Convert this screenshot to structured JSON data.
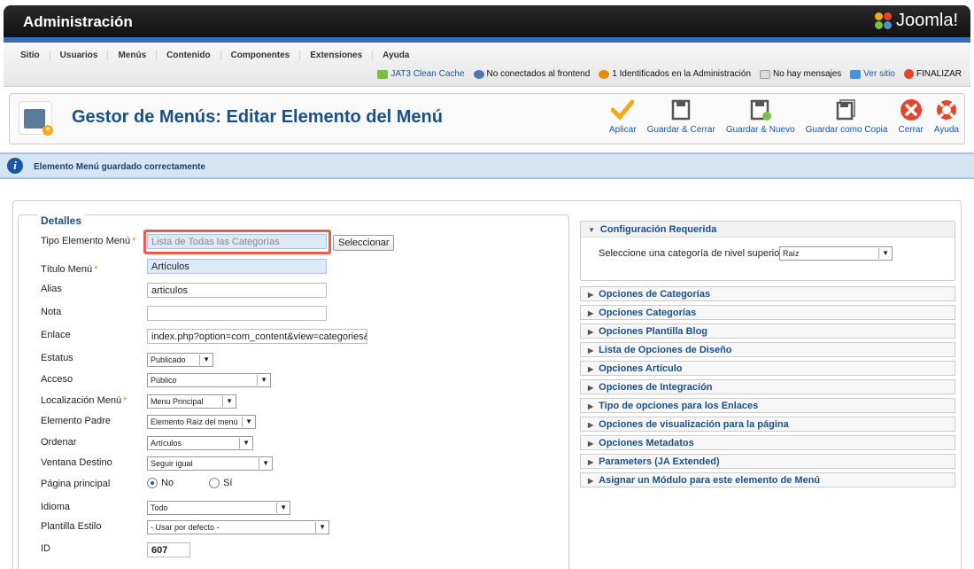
{
  "header": {
    "title": "Administración",
    "logo_text": "Joomla!"
  },
  "menu": [
    "Sitio",
    "Usuarios",
    "Menús",
    "Contenido",
    "Componentes",
    "Extensiones",
    "Ayuda"
  ],
  "status": {
    "cache": "JAT3 Clean Cache",
    "frontend": "No conectados al frontend",
    "admin": "1 Identificados en la Administración",
    "messages": "No hay mensajes",
    "view_site": "Ver sitio",
    "logout": "FINALIZAR"
  },
  "page": {
    "title": "Gestor de Menús: Editar Elemento del Menú"
  },
  "toolbar": {
    "apply": "Aplicar",
    "save_close": "Guardar & Cerrar",
    "save_new": "Guardar & Nuevo",
    "save_copy": "Guardar como Copia",
    "close": "Cerrar",
    "help": "Ayuda"
  },
  "message": "Elemento Menú guardado correctamente",
  "details": {
    "legend": "Detalles",
    "tipo_label": "Tipo Elemento Menú",
    "tipo_value": "Lista de Todas las Categorías",
    "select_btn": "Seleccionar",
    "titulo_label": "Título Menú",
    "titulo_value": "Artículos",
    "alias_label": "Alias",
    "alias_value": "articulos",
    "nota_label": "Nota",
    "nota_value": "",
    "enlace_label": "Enlace",
    "enlace_value": "index.php?option=com_content&view=categories&id=",
    "estatus_label": "Estatus",
    "estatus_value": "Publicado",
    "acceso_label": "Acceso",
    "acceso_value": "Público",
    "localizacion_label": "Localización Menú",
    "localizacion_value": "Menu Principal",
    "padre_label": "Elemento Padre",
    "padre_value": "Elemento Raíz del menú",
    "ordenar_label": "Ordenar",
    "ordenar_value": "Artículos",
    "ventana_label": "Ventana Destino",
    "ventana_value": "Seguir igual",
    "principal_label": "Página principal",
    "radio_no": "No",
    "radio_si": "Sí",
    "idioma_label": "Idioma",
    "idioma_value": "Todo",
    "plantilla_label": "Plantilla Estilo",
    "plantilla_value": "- Usar por defecto -",
    "id_label": "ID",
    "id_value": "607"
  },
  "right": {
    "req_title": "Configuración Requerida",
    "req_label": "Seleccione una categoría de nivel superior",
    "req_value": "Raíz",
    "accordions": [
      "Opciones de Categorías",
      "Opciones Categorías",
      "Opciones Plantilla Blog",
      "Lista de Opciones de Diseño",
      "Opciones Artículo",
      "Opciones de Integración",
      "Tipo de opciones para los Enlaces",
      "Opciones de visualización para la página",
      "Opciones Metadatos",
      "Parameters (JA Extended)",
      "Asignar un Módulo para este elemento de Menú"
    ]
  },
  "colors": {
    "brand_blue": "#1a57a7",
    "title_blue": "#1a4f8a",
    "highlight": "#ee5a4b",
    "required": "#e8890a"
  }
}
